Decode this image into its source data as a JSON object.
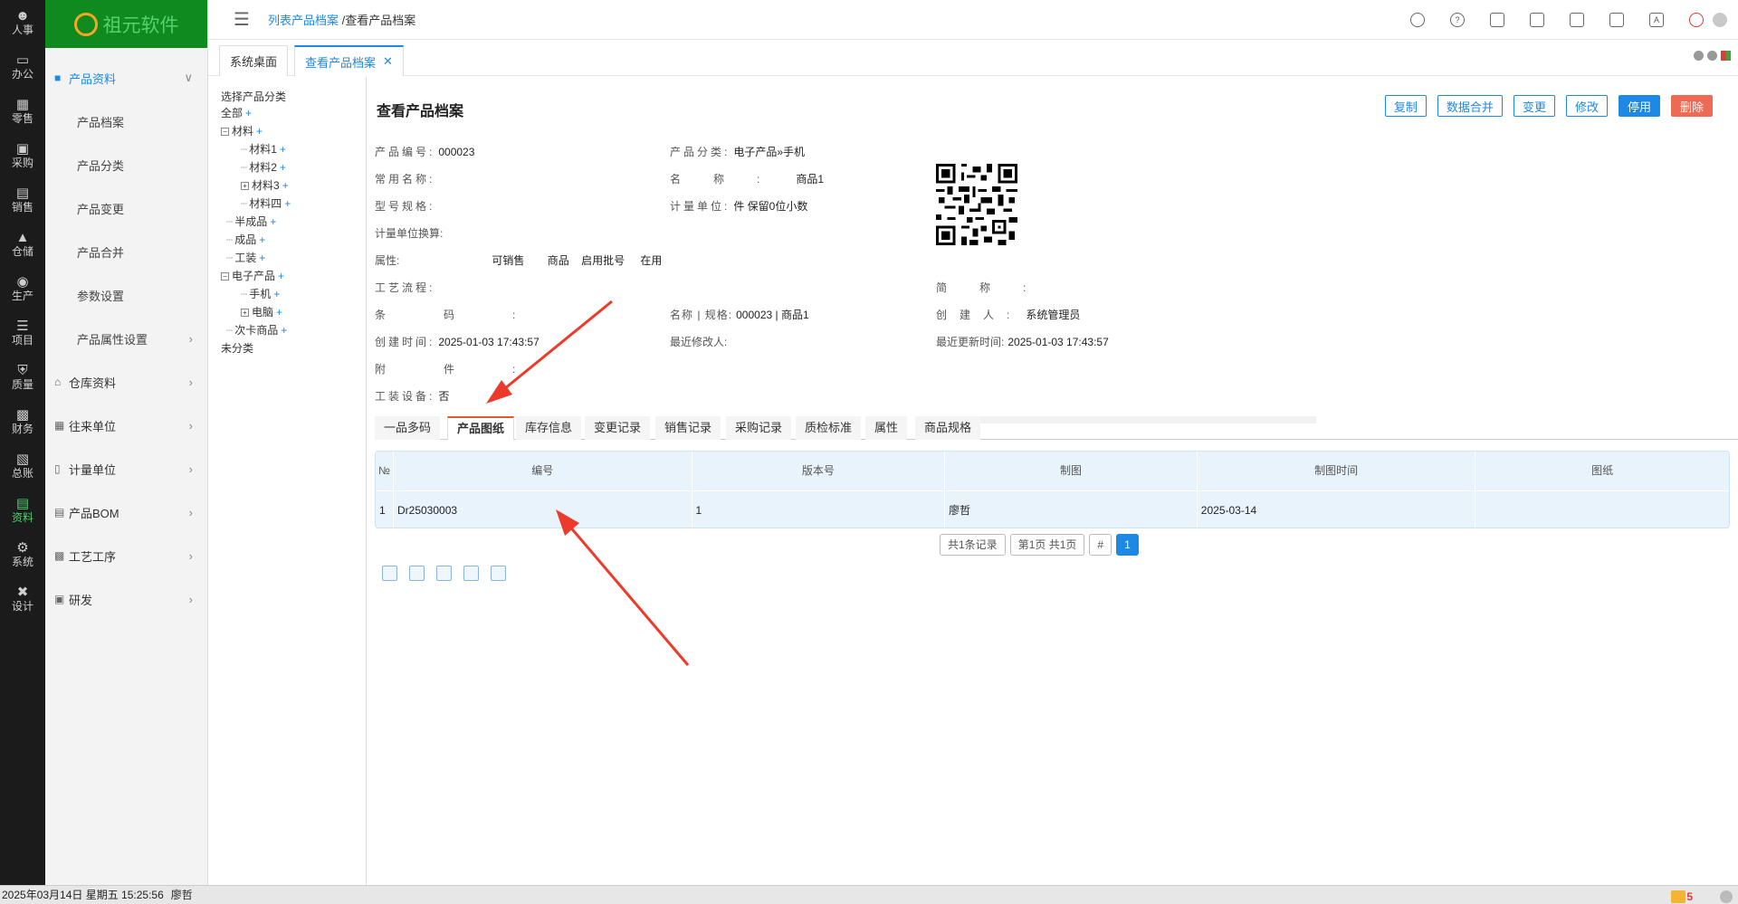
{
  "rail": [
    "人事",
    "办公",
    "零售",
    "采购",
    "销售",
    "仓储",
    "生产",
    "项目",
    "质量",
    "财务",
    "总账",
    "资料",
    "系统",
    "设计"
  ],
  "rail_active": "资料",
  "logo_text": "祖元软件",
  "sidebar": {
    "group_open": "产品资料",
    "sub_items": [
      "产品档案",
      "产品分类",
      "产品变更",
      "产品合并",
      "参数设置",
      "产品属性设置"
    ],
    "groups": [
      "仓库资料",
      "往来单位",
      "计量单位",
      "产品BOM",
      "工艺工序",
      "研发"
    ]
  },
  "breadcrumb": {
    "link": "列表产品档案",
    "sep": "/",
    "current": "查看产品档案"
  },
  "tabs": {
    "home": "系统桌面",
    "active": "查看产品档案",
    "close": "✕"
  },
  "tree": {
    "header": "选择产品分类",
    "nodes": [
      {
        "label": "全部",
        "plus": "+"
      },
      {
        "label": "材料",
        "plus": "+"
      },
      {
        "label": "材料1",
        "plus": "+"
      },
      {
        "label": "材料2",
        "plus": "+"
      },
      {
        "label": "材料3",
        "plus": "+"
      },
      {
        "label": "材料四",
        "plus": "+"
      },
      {
        "label": "半成品",
        "plus": "+"
      },
      {
        "label": "成品",
        "plus": "+"
      },
      {
        "label": "工装",
        "plus": "+"
      },
      {
        "label": "电子产品",
        "plus": "+"
      },
      {
        "label": "手机",
        "plus": "+"
      },
      {
        "label": "电脑",
        "plus": "+"
      },
      {
        "label": "次卡商品",
        "plus": "+"
      },
      {
        "label": "未分类",
        "plus": ""
      }
    ]
  },
  "page_title": "查看产品档案",
  "actions": [
    "复制",
    "数据合并",
    "变更",
    "修改",
    "停用",
    "删除"
  ],
  "fields": {
    "code_label": "产品编号:",
    "code": "000023",
    "category_label": "产品分类:",
    "category": "电子产品»手机",
    "common_name_label": "常用名称:",
    "name_label": "名称:",
    "name": "商品1",
    "model_label": "型号规格:",
    "unit_label": "计量单位:",
    "unit": "件  保留0位小数",
    "unit_conv_label": "计量单位换算:",
    "attr_label": "属性:",
    "attr_values": [
      "可销售",
      "商品",
      "启用批号",
      "在用"
    ],
    "process_label": "工艺流程:",
    "short_label": "简称:",
    "barcode_label": "条码:",
    "name_spec_label": "名称 | 规格:",
    "name_spec": "000023 | 商品1",
    "creator_label": "创建人:",
    "creator": "系统管理员",
    "created_label": "创建时间:",
    "created": "2025-01-03 17:43:57",
    "modifier_label": "最近修改人:",
    "updated_label": "最近更新时间:",
    "updated": "2025-01-03 17:43:57",
    "attach_label": "附件:",
    "tooling_label": "工装设备:",
    "tooling": "否"
  },
  "subtabs": [
    "一品多码",
    "产品图纸",
    "库存信息",
    "变更记录",
    "销售记录",
    "采购记录",
    "质检标准",
    "属性",
    "商品规格"
  ],
  "subtab_active": "产品图纸",
  "grid": {
    "columns": [
      "№",
      "编号",
      "版本号",
      "制图",
      "制图时间",
      "图纸"
    ],
    "rows": [
      [
        "1",
        "Dr25030003",
        "1",
        "廖哲",
        "2025-03-14",
        ""
      ]
    ]
  },
  "pager": [
    "共1条记录",
    "第1页 共1页",
    "#",
    "1"
  ],
  "statusbar": {
    "datetime": "2025年03月14日 星期五 15:25:56",
    "user": "廖哲",
    "msg_count": "5"
  },
  "colors": {
    "accent": "#1e88e5",
    "logo_bg": "#0e8a1f",
    "danger": "#ef6a55",
    "arrow": "#ee3a2a"
  }
}
